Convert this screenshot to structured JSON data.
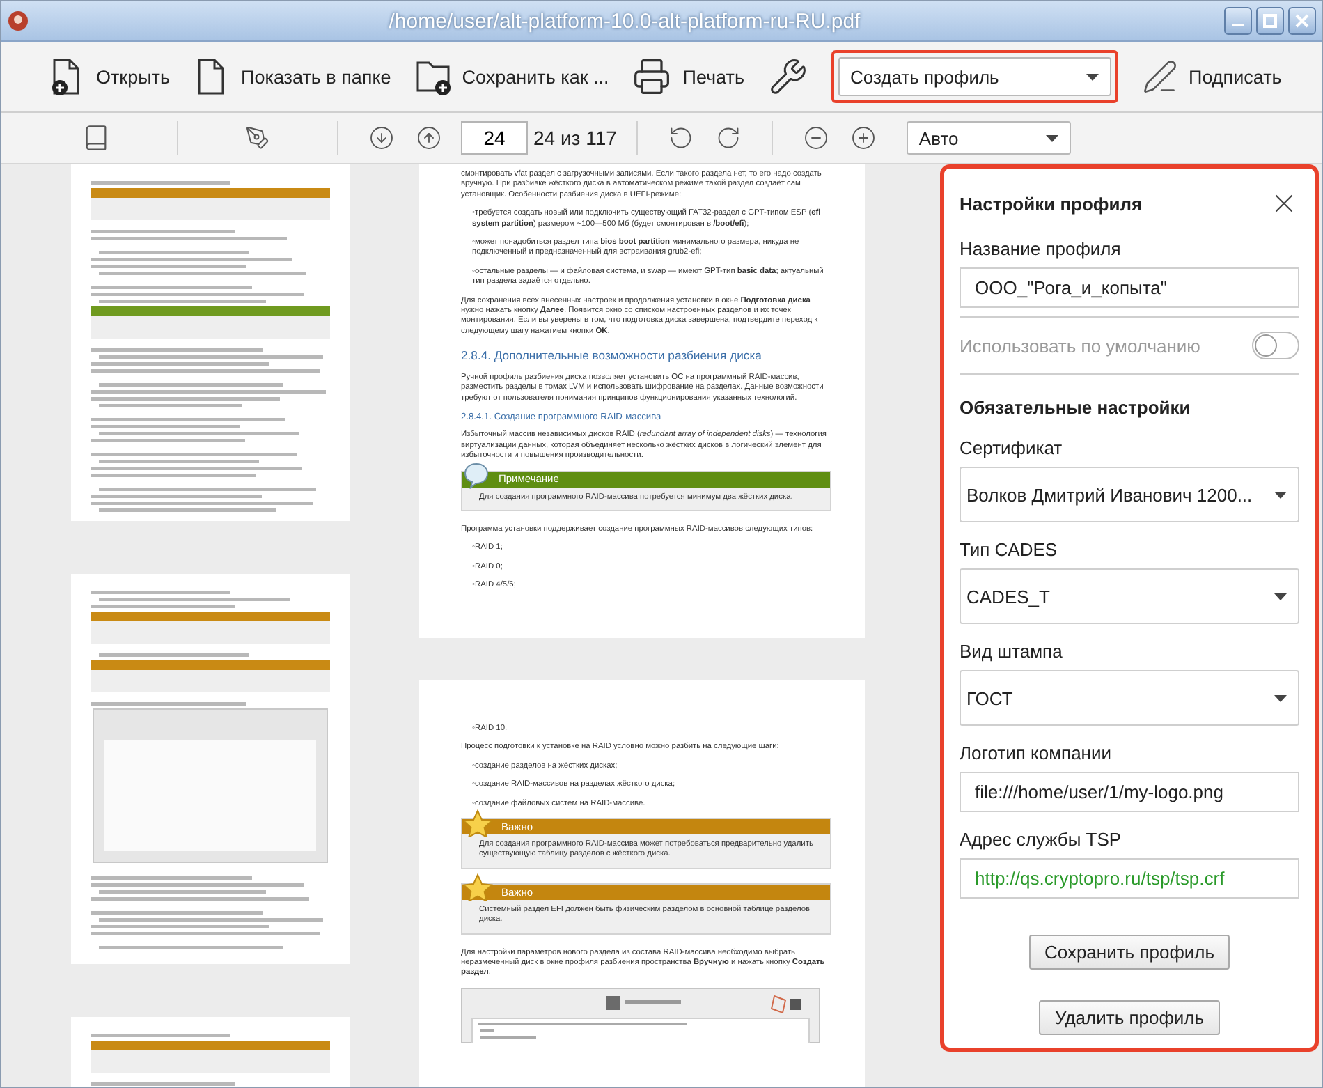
{
  "window": {
    "title": "/home/user/alt-platform-10.0-alt-platform-ru-RU.pdf"
  },
  "toolbar": {
    "buttons": [
      {
        "kind": "open",
        "label": "Открыть"
      },
      {
        "kind": "folder",
        "label": "Показать в папке"
      },
      {
        "kind": "save",
        "label": "Сохранить как ..."
      },
      {
        "kind": "print",
        "label": "Печать"
      },
      {
        "kind": "settings"
      }
    ],
    "profile_select": {
      "value": "Создать профиль",
      "highlighted": true
    },
    "sign_button": {
      "label": "Подписать"
    }
  },
  "navbar": {
    "page_input": "24",
    "page_count": "24 из 117",
    "zoom_select": "Авто"
  },
  "document": {
    "pages": [
      {
        "blocks": [
          {
            "kind": "paragraph",
            "text": "смонтировать vfat раздел с загрузочными записями. Если такого раздела нет, то его надо создать вручную. При разбивке жёсткого диска в автоматическом режиме такой раздел создаёт сам установщик. Особенности разбиения диска в UEFI-режиме:"
          },
          {
            "kind": "bullet",
            "text": "◦требуется создать новый или подключить существующий FAT32-раздел с GPT-типом ESP (**efi system partition**) размером ~100—500 Мб (будет смонтирован в **/boot/efi**);"
          },
          {
            "kind": "bullet",
            "text": "◦может понадобиться раздел типа **bios boot partition** минимального размера, никуда не подключенный и предназначенный для встраивания grub2-efi;"
          },
          {
            "kind": "bullet",
            "text": "◦остальные разделы — и файловая система, и swap — имеют GPT-тип **basic data**; актуальный тип раздела задаётся отдельно."
          },
          {
            "kind": "paragraph",
            "text": "Для сохранения всех внесенных настроек и продолжения установки в окне **Подготовка диска** нужно нажать кнопку **Далее**. Появится окно со списком настроенных разделов и их точек монтирования. Если вы уверены в том, что подготовка диска завершена, подтвердите переход к следующему шагу нажатием кнопки **OK**."
          },
          {
            "kind": "heading2",
            "text": "2.8.4. Дополнительные возможности разбиения диска"
          },
          {
            "kind": "paragraph",
            "text": "Ручной профиль разбиения диска позволяет установить ОС на программный RAID-массив, разместить разделы в томах LVM и использовать шифрование на разделах. Данные возможности требуют от пользователя понимания принципов функционирования указанных технологий."
          },
          {
            "kind": "heading3",
            "text": "2.8.4.1. Создание программного RAID-массива"
          },
          {
            "kind": "paragraph",
            "text": "Избыточный массив независимых дисков RAID (*redundant array of independent disks*) — технология виртуализации данных, которая объединяет несколько жёстких дисков в логический элемент для избыточности и повышения производительности."
          },
          {
            "kind": "note",
            "title": "Примечание",
            "text": "Для создания программного RAID-массива потребуется минимум два жёстких диска."
          },
          {
            "kind": "paragraph",
            "text": "Программа установки поддерживает создание программных RAID-массивов следующих типов:"
          },
          {
            "kind": "bullet",
            "text": "◦RAID 1;"
          },
          {
            "kind": "bullet",
            "text": "◦RAID 0;"
          },
          {
            "kind": "bullet",
            "text": "◦RAID 4/5/6;"
          }
        ]
      },
      {
        "blocks": [
          {
            "kind": "bullet",
            "text": "◦RAID 10."
          },
          {
            "kind": "paragraph",
            "text": "Процесс подготовки к установке на RAID условно можно разбить на следующие шаги:"
          },
          {
            "kind": "bullet",
            "text": "◦создание разделов на жёстких дисках;"
          },
          {
            "kind": "bullet",
            "text": "◦создание RAID-массивов на разделах жёсткого диска;"
          },
          {
            "kind": "bullet",
            "text": "◦создание файловых систем на RAID-массиве."
          },
          {
            "kind": "important",
            "title": "Важно",
            "text": "Для создания программного RAID-массива может потребоваться предварительно удалить существующую таблицу разделов с жёсткого диска."
          },
          {
            "kind": "important",
            "title": "Важно",
            "text": "Системный раздел EFI должен быть физическим разделом в основной таблице разделов диска."
          },
          {
            "kind": "paragraph",
            "text": "Для настройки параметров нового раздела из состава RAID-массива необходимо выбрать неразмеченный диск в окне профиля разбиения пространства **Вручную** и нажать кнопку **Создать раздел**."
          },
          {
            "kind": "screenshot"
          }
        ]
      }
    ]
  },
  "panel": {
    "highlighted": true,
    "title": "Настройки профиля",
    "name_label": "Название профиля",
    "name_value": "ООО_\"Рога_и_копыта\"",
    "default_toggle": {
      "label": "Использовать по умолчанию",
      "on": false,
      "disabled": true
    },
    "section_title": "Обязательные настройки",
    "fields": [
      {
        "kind": "select",
        "label": "Сертификат",
        "value": "Волков Дмитрий Иванович 1200..."
      },
      {
        "kind": "select",
        "label": "Тип CADES",
        "value": "CADES_T"
      },
      {
        "kind": "select",
        "label": "Вид штампа",
        "value": "ГОСТ"
      },
      {
        "kind": "text",
        "label": "Логотип компании",
        "value": "file:///home/user/1/my-logo.png"
      },
      {
        "kind": "url",
        "label": "Адрес службы TSP",
        "value": "http://qs.cryptopro.ru/tsp/tsp.crf"
      }
    ],
    "buttons": [
      "Сохранить профиль",
      "Удалить профиль"
    ]
  }
}
